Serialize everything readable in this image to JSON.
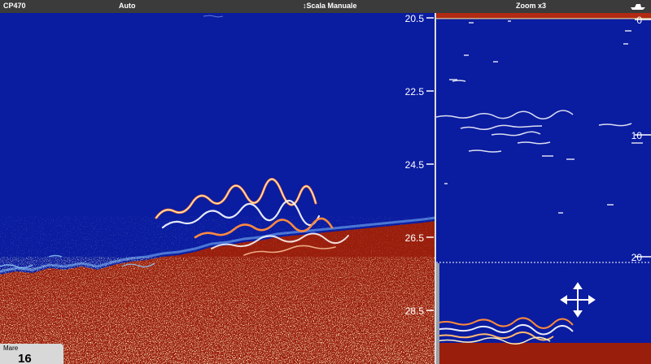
{
  "topbar": {
    "model": "CP470",
    "gain_mode": "Auto",
    "scale_mode": "Scala Manuale",
    "scale_icon": "updown-arrow-icon",
    "zoom": "Zoom x3",
    "boat_icon": "boat-icon"
  },
  "left_scale": {
    "ticks": [
      "20.5",
      "22.5",
      "24.5",
      "26.5",
      "28.5"
    ]
  },
  "right_scale": {
    "ticks": [
      "0",
      "10",
      "20"
    ]
  },
  "mode_box": {
    "label": "Mare",
    "value": "16"
  },
  "colors": {
    "water": "#0a1ca0",
    "bottom": "#9a1e0c",
    "echo_warm": "#f4e8a0",
    "topbar": "#3b3b3b"
  },
  "cursor_icon": "crosshair-icon"
}
